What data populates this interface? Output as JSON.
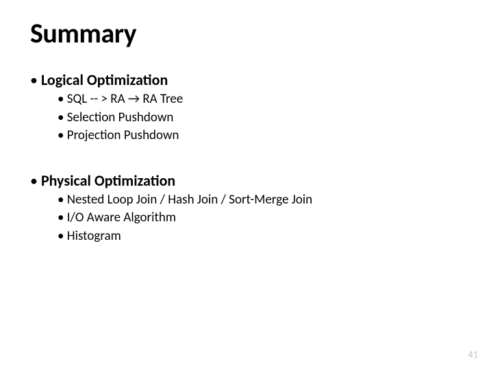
{
  "title": "Summary",
  "sections": [
    {
      "heading": "Logical  Optimization",
      "items": [
        "SQL  --  >  RA  →  RA  Tree",
        "Selection  Pushdown",
        "Projection  Pushdown"
      ]
    },
    {
      "heading": "Physical  Optimization",
      "items": [
        "Nested  Loop  Join  /  Hash  Join  /  Sort-Merge  Join",
        "I/O  Aware  Algorithm",
        "Histogram"
      ]
    }
  ],
  "page_number": "41"
}
